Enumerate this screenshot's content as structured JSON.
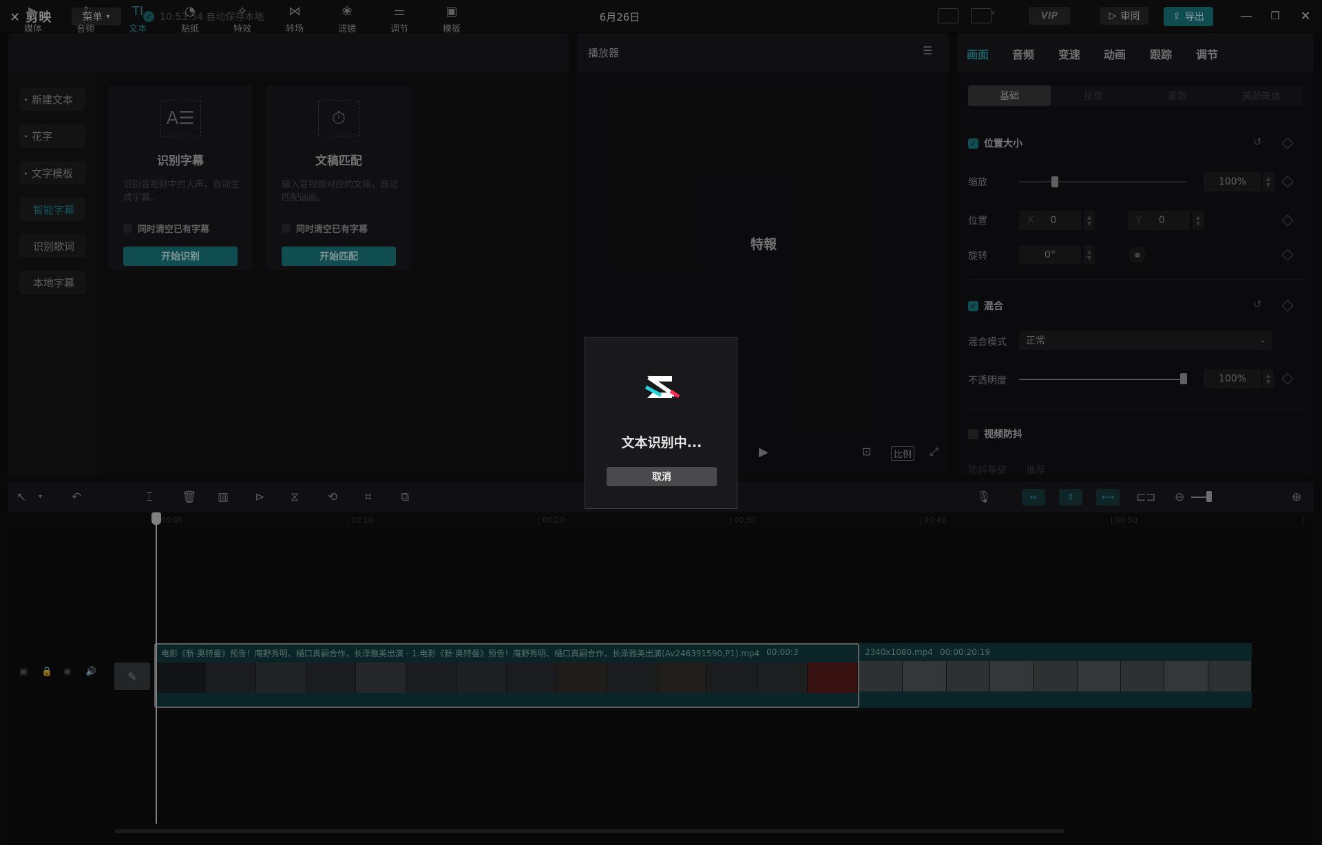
{
  "app": {
    "name": "剪映",
    "menu_label": "菜单",
    "autosave": "10:53:54 自动保存本地",
    "project_title": "6月26日"
  },
  "header": {
    "vip": "VIP",
    "review": "审阅",
    "export": "导出"
  },
  "toolbar": {
    "items": [
      {
        "label": "媒体",
        "icon": "▶"
      },
      {
        "label": "音频",
        "icon": "♪"
      },
      {
        "label": "文本",
        "icon": "TI"
      },
      {
        "label": "贴纸",
        "icon": "◔"
      },
      {
        "label": "特效",
        "icon": "✧"
      },
      {
        "label": "转场",
        "icon": "⋈"
      },
      {
        "label": "滤镜",
        "icon": "❀"
      },
      {
        "label": "调节",
        "icon": "⚌"
      },
      {
        "label": "模板",
        "icon": "▣"
      }
    ],
    "active": "文本"
  },
  "leftnav": {
    "items": [
      "新建文本",
      "花字",
      "文字模板",
      "智能字幕",
      "识别歌词",
      "本地字幕"
    ],
    "active": "智能字幕"
  },
  "cards": [
    {
      "title": "识别字幕",
      "desc": "识别音视频中的人声，自动生成字幕。",
      "check": "同时清空已有字幕",
      "button": "开始识别",
      "icon": "A☰"
    },
    {
      "title": "文稿匹配",
      "desc": "输入音视频对应的文稿，自动匹配画面。",
      "check": "同时清空已有字幕",
      "button": "开始匹配",
      "icon": "⏱"
    }
  ],
  "player": {
    "label": "播放器",
    "preview_text": "特報",
    "ratio_label": "比例"
  },
  "rightpanel": {
    "tabs": [
      "画面",
      "音频",
      "变速",
      "动画",
      "跟踪",
      "调节"
    ],
    "active_tab": "画面",
    "subtabs": [
      "基础",
      "抠像",
      "蒙版",
      "美颜美体"
    ],
    "active_subtab": "基础",
    "position_size": {
      "title": "位置大小",
      "scale_label": "缩放",
      "scale_value": "100%",
      "scale_fraction": 0.2,
      "position_label": "位置",
      "x_label": "X",
      "x_value": "0",
      "y_label": "Y",
      "y_value": "0",
      "rotate_label": "旋转",
      "rotate_value": "0°"
    },
    "blend": {
      "title": "混合",
      "mode_label": "混合模式",
      "mode_value": "正常",
      "opacity_label": "不透明度",
      "opacity_value": "100%",
      "opacity_fraction": 1.0
    },
    "stabilize": {
      "title": "视频防抖",
      "level_label": "防抖等级",
      "level_value": "推荐"
    }
  },
  "timeline": {
    "ruler_labels": [
      "00:00",
      "00:10",
      "00:20",
      "00:30",
      "00:40",
      "00:50"
    ],
    "clip1_label": "电影《新·奥特曼》预告！庵野秀明、樋口真嗣合作，长泽雅美出演 - 1.电影《新·奥特曼》预告！庵野秀明、樋口真嗣合作，长泽雅美出演(Av246391590,P1).mp4",
    "clip1_duration": "00:00:3",
    "clip2_label": "2340x1080.mp4",
    "clip2_duration": "00:00:20:19"
  },
  "dialog": {
    "title": "文本识别中...",
    "cancel": "取消"
  }
}
